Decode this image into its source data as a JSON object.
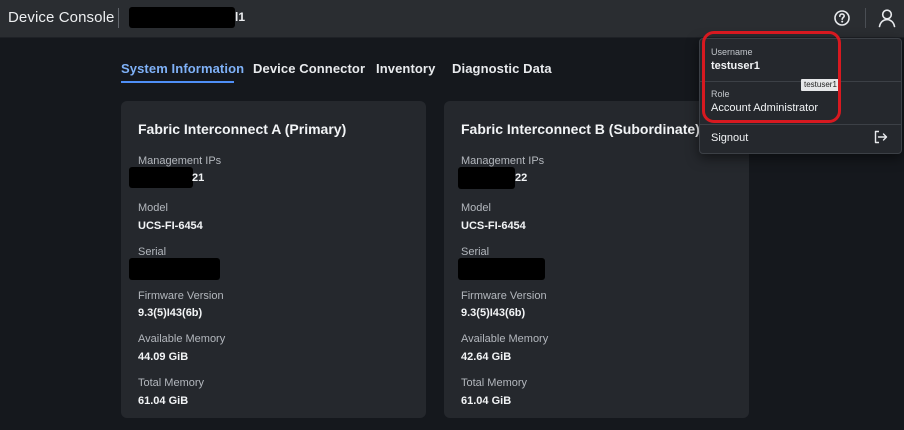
{
  "header": {
    "app_title": "Device Console",
    "device_name_suffix": "l1",
    "help_icon": "help-circle-icon",
    "user_icon": "user-icon"
  },
  "tabs": [
    {
      "label": "System Information",
      "active": true
    },
    {
      "label": "Device Connector",
      "active": false
    },
    {
      "label": "Inventory",
      "active": false
    },
    {
      "label": "Diagnostic Data",
      "active": false
    }
  ],
  "cards": [
    {
      "title": "Fabric Interconnect A (Primary)",
      "management_ips_label": "Management IPs",
      "management_ips_suffix": "21",
      "model_label": "Model",
      "model": "UCS-FI-6454",
      "serial_label": "Serial",
      "firmware_label": "Firmware Version",
      "firmware": "9.3(5)I43(6b)",
      "available_memory_label": "Available Memory",
      "available_memory": "44.09 GiB",
      "total_memory_label": "Total Memory",
      "total_memory": "61.04 GiB"
    },
    {
      "title": "Fabric Interconnect B (Subordinate)",
      "management_ips_label": "Management IPs",
      "management_ips_suffix": "22",
      "model_label": "Model",
      "model": "UCS-FI-6454",
      "serial_label": "Serial",
      "firmware_label": "Firmware Version",
      "firmware": "9.3(5)I43(6b)",
      "available_memory_label": "Available Memory",
      "available_memory": "42.64 GiB",
      "total_memory_label": "Total Memory",
      "total_memory": "61.04 GiB"
    }
  ],
  "user_menu": {
    "username_label": "Username",
    "username": "testuser1",
    "tooltip": "testuser1",
    "role_label": "Role",
    "role": "Account Administrator",
    "signout_label": "Signout",
    "signout_icon": "signout-icon"
  },
  "colors": {
    "accent": "#4f8ff7",
    "highlight": "#d71920",
    "background": "#15181d",
    "card": "#25282d"
  }
}
